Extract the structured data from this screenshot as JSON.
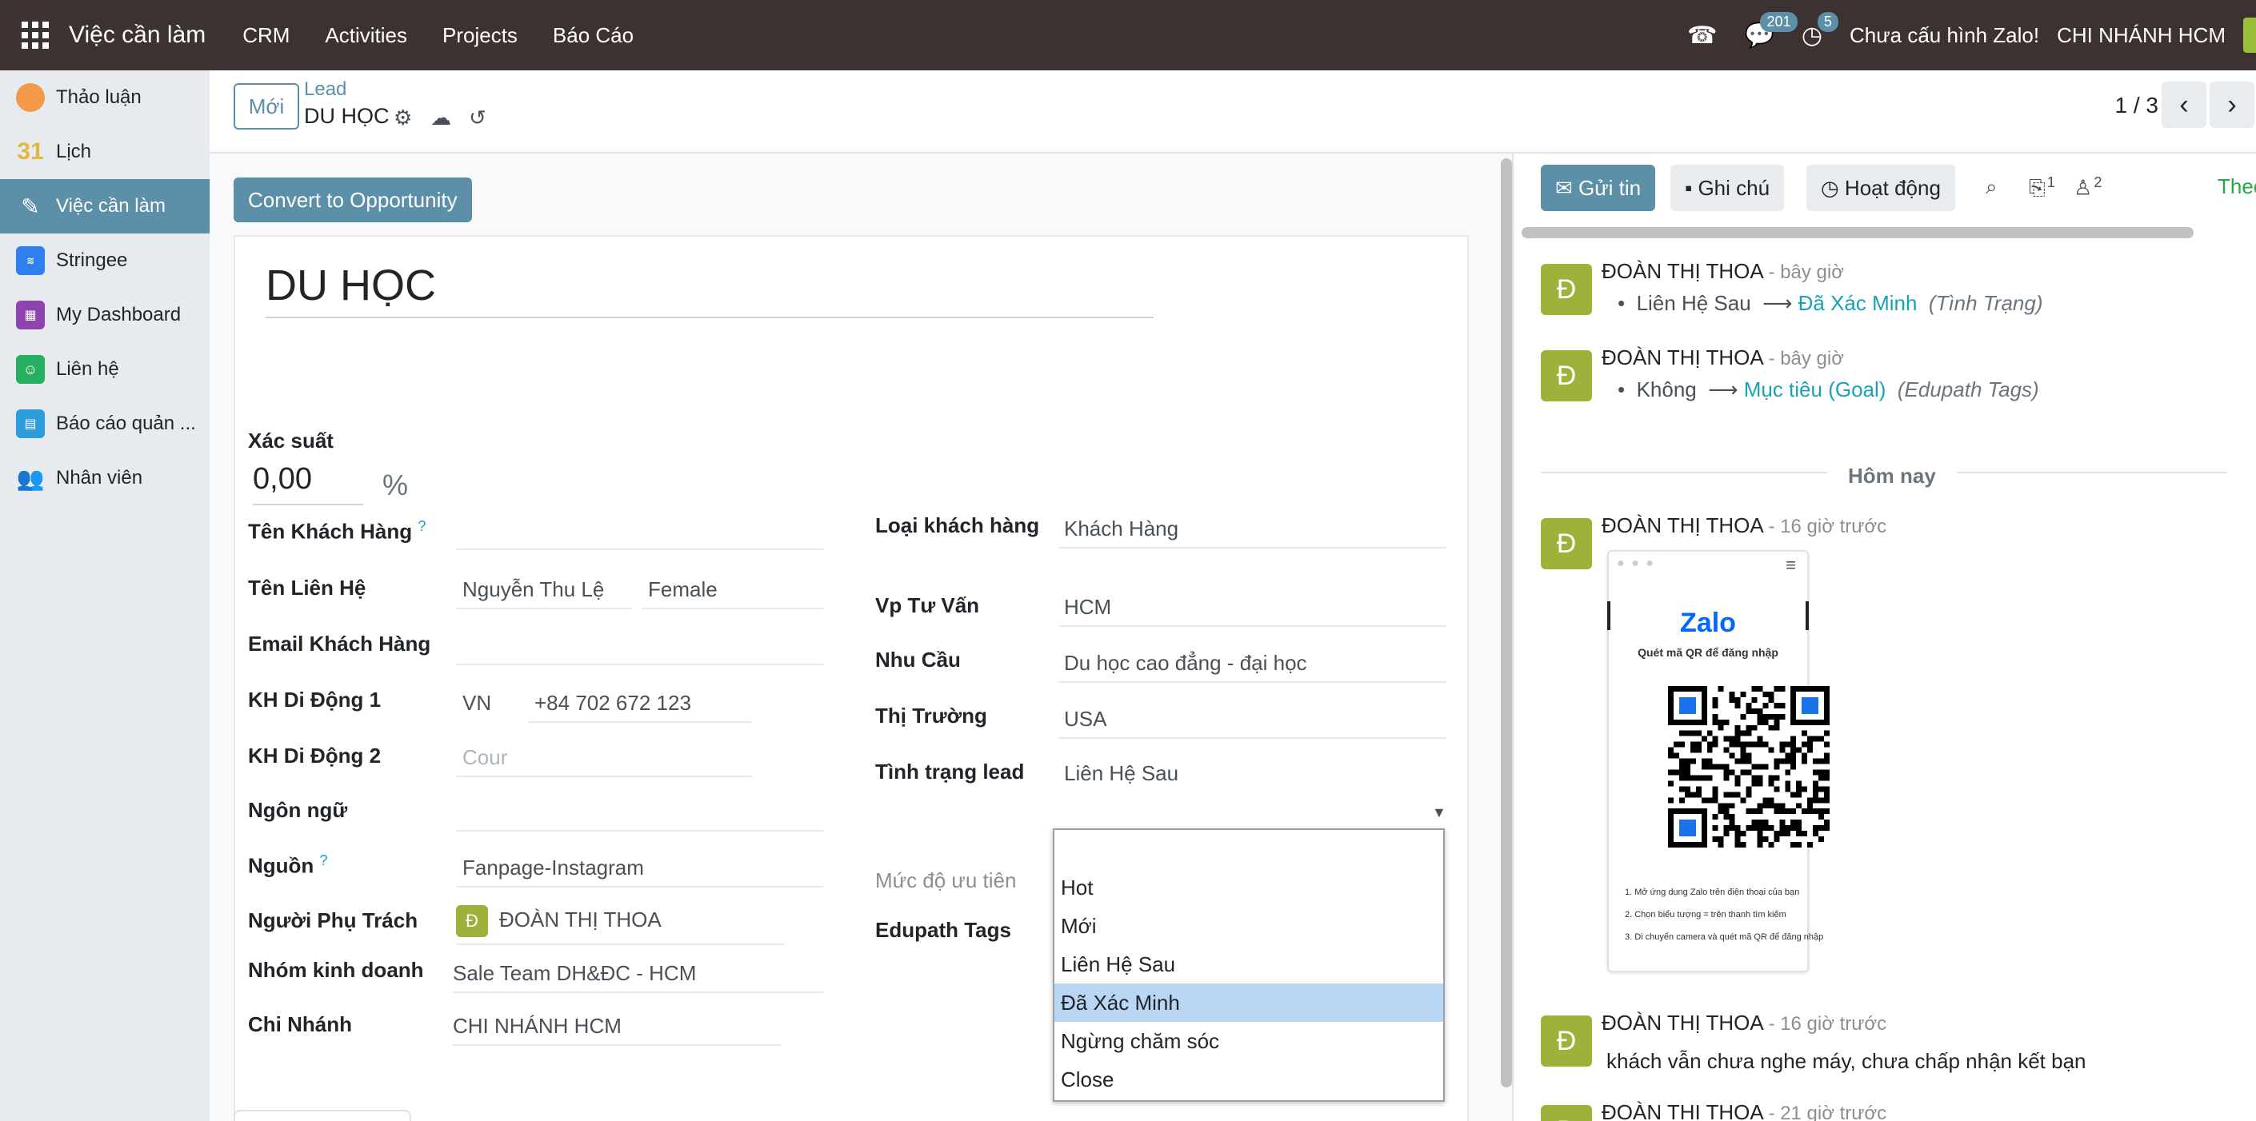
{
  "topbar": {
    "app_title": "Việc cần làm",
    "menus": [
      "CRM",
      "Activities",
      "Projects",
      "Báo Cáo"
    ],
    "messages_count": "201",
    "activities_count": "5",
    "zalo_status": "Chưa cấu hình Zalo!",
    "company": "CHI NHÁNH HCM"
  },
  "sidebar": {
    "items": [
      {
        "label": "Thảo luận",
        "icon": "discuss-icon",
        "color": "#f2994a"
      },
      {
        "label": "Lịch",
        "icon": "calendar-icon",
        "color": "#4a90d9"
      },
      {
        "label": "Việc cần làm",
        "icon": "todo-icon",
        "color": "#5c8fa8"
      },
      {
        "label": "Stringee",
        "icon": "stringee-icon",
        "color": "#2f80ed"
      },
      {
        "label": "My Dashboard",
        "icon": "dashboard-icon",
        "color": "#8e44ad"
      },
      {
        "label": "Liên hệ",
        "icon": "contacts-icon",
        "color": "#27ae60"
      },
      {
        "label": "Báo cáo quản ...",
        "icon": "report-icon",
        "color": "#2d9cdb"
      },
      {
        "label": "Nhân viên",
        "icon": "employees-icon",
        "color": "#eb5757"
      }
    ]
  },
  "control_panel": {
    "new_button": "Mới",
    "breadcrumb_parent": "Lead",
    "breadcrumb_current": "DU HỌC",
    "pager": "1 / 3"
  },
  "form": {
    "convert_button": "Convert to Opportunity",
    "title": "DU HỌC",
    "probability_label": "Xác suất",
    "probability_value": "0,00",
    "probability_unit": "%",
    "left": {
      "ten_khach_hang_label": "Tên Khách Hàng",
      "help_mark": "?",
      "ten_lien_he_label": "Tên Liên Hệ",
      "ten_lien_he_value": "Nguyễn Thu Lệ",
      "gioi_tinh_value": "Female",
      "email_label": "Email Khách Hàng",
      "kh_di_dong_1_label": "KH Di Động 1",
      "country_code": "VN",
      "phone_1": "+84 702 672 123",
      "kh_di_dong_2_label": "KH Di Động 2",
      "phone_2_placeholder": "Cour",
      "ngon_ngu_label": "Ngôn ngữ",
      "nguon_label": "Nguồn",
      "nguon_value": "Fanpage-Instagram",
      "nguoi_phu_trach_label": "Người Phụ Trách",
      "nguoi_phu_trach_initial": "Đ",
      "nguoi_phu_trach_value": "ĐOÀN THỊ THOA",
      "nhom_kinh_doanh_label": "Nhóm kinh doanh",
      "nhom_kinh_doanh_value": "Sale Team DH&ĐC - HCM",
      "chi_nhanh_label": "Chi Nhánh",
      "chi_nhanh_value": "CHI NHÁNH HCM"
    },
    "right": {
      "loai_khach_hang_label": "Loại khách hàng",
      "loai_khach_hang_value": "Khách Hàng",
      "vp_tu_van_label": "Vp Tư Vấn",
      "vp_tu_van_value": "HCM",
      "nhu_cau_label": "Nhu Cầu",
      "nhu_cau_value": "Du học cao đẳng - đại học",
      "thi_truong_label": "Thị Trường",
      "thi_truong_value": "USA",
      "tinh_trang_label": "Tình trạng lead",
      "tinh_trang_value": "Liên Hệ Sau",
      "muc_do_uu_tien_label": "Mức độ ưu tiên",
      "edupath_tags_label": "Edupath Tags"
    },
    "status_dropdown": {
      "options": [
        "",
        "Hot",
        "Mới",
        "Liên Hệ Sau",
        "Đã Xác Minh",
        "Ngừng chăm sóc",
        "Close"
      ],
      "highlighted": "Đã Xác Minh"
    }
  },
  "chatter": {
    "send_message": "Gửi tin",
    "log_note": "Ghi chú",
    "activities": "Hoạt động",
    "attachments_count": "1",
    "followers_count": "2",
    "follow_label": "Theo",
    "today_label": "Hôm nay",
    "messages": [
      {
        "initial": "Đ",
        "author": "ĐOÀN THỊ THOA",
        "time": "- bây giờ",
        "old": "Liên Hệ Sau",
        "new": "Đã Xác Minh",
        "field": "(Tình Trạng)"
      },
      {
        "initial": "Đ",
        "author": "ĐOÀN THỊ THOA",
        "time": "- bây giờ",
        "old": "Không",
        "new": "Mục tiêu (Goal)",
        "field": "(Edupath Tags)"
      },
      {
        "initial": "Đ",
        "author": "ĐOÀN THỊ THOA",
        "time": "- 16 giờ trước"
      },
      {
        "initial": "Đ",
        "author": "ĐOÀN THỊ THOA",
        "time": "- 16 giờ trước",
        "body": "khách vẫn chưa nghe máy, chưa chấp nhận kết bạn"
      },
      {
        "initial": "Đ",
        "author": "ĐOÀN THỊ THOA",
        "time": "- 21 giờ trước"
      }
    ],
    "zalo_card": {
      "logo": "Zalo",
      "subtitle": "Quét mã QR để đăng nhập",
      "steps": [
        "1. Mở ứng dụng Zalo trên điện thoại của bạn",
        "2. Chọn biểu tượng ⌗ trên thanh tìm kiếm",
        "3. Di chuyển camera và quét mã QR để đăng nhập"
      ]
    }
  }
}
